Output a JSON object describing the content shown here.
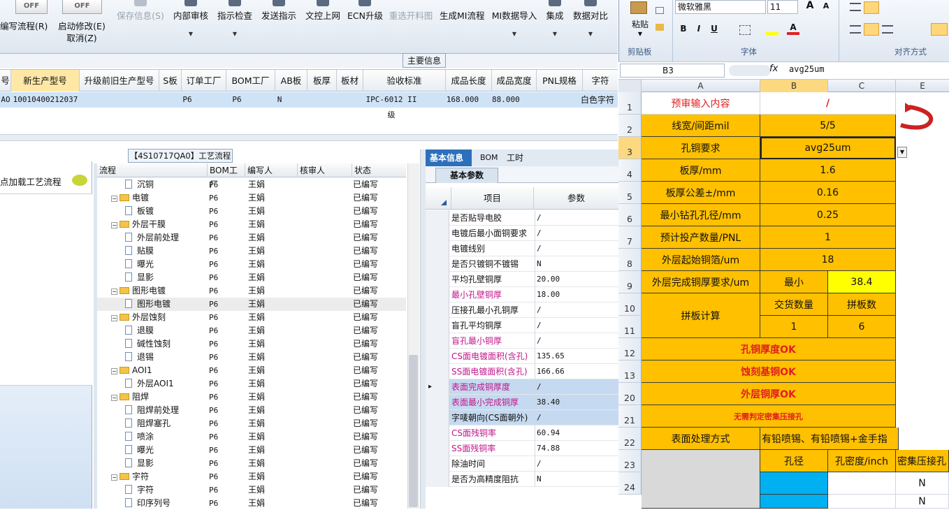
{
  "toolbar": {
    "toggle1": "OFF",
    "toggle2": "OFF",
    "btn_flow": "编写流程(R)",
    "btn_auto": "启动修改(E)",
    "btn_cancel": "取消(Z)",
    "btn_save": "保存信息(S)",
    "btn_audit": "内部审核",
    "btn_check": "指示检查",
    "btn_send": "发送指示",
    "btn_upload": "文控上网",
    "btn_ecn": "ECN升级",
    "btn_reselect": "重选开料图",
    "btn_mi": "生成MI流程",
    "btn_import": "MI数据导入",
    "btn_integrate": "集成",
    "btn_compare": "数据对比"
  },
  "main_info_label": "主要信息",
  "grid": {
    "headers": [
      "号",
      "新生产型号",
      "升级前旧生产型号",
      "S板",
      "订单工厂",
      "BOM工厂",
      "AB板",
      "板厚",
      "板材",
      "验收标准",
      "成品长度",
      "成品宽度",
      "PNL规格",
      "字符"
    ],
    "row": [
      "AO",
      "10010400212037",
      "",
      "",
      "P6",
      "P6",
      "N",
      "",
      "",
      "IPC-6012 II级",
      "168.000",
      "88.000",
      "",
      "白色字符"
    ]
  },
  "left_panel": {
    "load_label": "点加载工艺流程"
  },
  "flow_title": "【4S10717QA0】工艺流程",
  "tree": {
    "headers": [
      "流程",
      "BOM工厂",
      "编写人",
      "核审人",
      "状态"
    ],
    "rows": [
      {
        "name": "沉铜",
        "f": "P6",
        "w": "王娟",
        "s": "已编写",
        "lvl": 2
      },
      {
        "name": "电镀",
        "f": "P6",
        "w": "王娟",
        "s": "已编写",
        "lvl": 1
      },
      {
        "name": "板镀",
        "f": "P6",
        "w": "王娟",
        "s": "已编写",
        "lvl": 2
      },
      {
        "name": "外层干膜",
        "f": "P6",
        "w": "王娟",
        "s": "已编写",
        "lvl": 1
      },
      {
        "name": "外层前处理",
        "f": "P6",
        "w": "王娟",
        "s": "已编写",
        "lvl": 2
      },
      {
        "name": "贴膜",
        "f": "P6",
        "w": "王娟",
        "s": "已编写",
        "lvl": 2
      },
      {
        "name": "曝光",
        "f": "P6",
        "w": "王娟",
        "s": "已编写",
        "lvl": 2
      },
      {
        "name": "显影",
        "f": "P6",
        "w": "王娟",
        "s": "已编写",
        "lvl": 2
      },
      {
        "name": "图形电镀",
        "f": "P6",
        "w": "王娟",
        "s": "已编写",
        "lvl": 1
      },
      {
        "name": "图形电镀",
        "f": "P6",
        "w": "王娟",
        "s": "已编写",
        "lvl": 2
      },
      {
        "name": "外层蚀刻",
        "f": "P6",
        "w": "王娟",
        "s": "已编写",
        "lvl": 1
      },
      {
        "name": "退膜",
        "f": "P6",
        "w": "王娟",
        "s": "已编写",
        "lvl": 2
      },
      {
        "name": "碱性蚀刻",
        "f": "P6",
        "w": "王娟",
        "s": "已编写",
        "lvl": 2
      },
      {
        "name": "退锡",
        "f": "P6",
        "w": "王娟",
        "s": "已编写",
        "lvl": 2
      },
      {
        "name": "AOI1",
        "f": "P6",
        "w": "王娟",
        "s": "已编写",
        "lvl": 1
      },
      {
        "name": "外层AOI1",
        "f": "P6",
        "w": "王娟",
        "s": "已编写",
        "lvl": 2
      },
      {
        "name": "阻焊",
        "f": "P6",
        "w": "王娟",
        "s": "已编写",
        "lvl": 1
      },
      {
        "name": "阻焊前处理",
        "f": "P6",
        "w": "王娟",
        "s": "已编写",
        "lvl": 2
      },
      {
        "name": "阻焊塞孔",
        "f": "P6",
        "w": "王娟",
        "s": "已编写",
        "lvl": 2
      },
      {
        "name": "喷涂",
        "f": "P6",
        "w": "王娟",
        "s": "已编写",
        "lvl": 2
      },
      {
        "name": "曝光",
        "f": "P6",
        "w": "王娟",
        "s": "已编写",
        "lvl": 2
      },
      {
        "name": "显影",
        "f": "P6",
        "w": "王娟",
        "s": "已编写",
        "lvl": 2
      },
      {
        "name": "字符",
        "f": "P6",
        "w": "王娟",
        "s": "已编写",
        "lvl": 1
      },
      {
        "name": "字符",
        "f": "P6",
        "w": "王娟",
        "s": "已编写",
        "lvl": 2
      },
      {
        "name": "印序列号",
        "f": "P6",
        "w": "王娟",
        "s": "已编写",
        "lvl": 2
      }
    ]
  },
  "params": {
    "tabs": [
      "基本信息",
      "BOM",
      "工时"
    ],
    "subtab": "基本参数",
    "headers": [
      "项目",
      "参数"
    ],
    "rows": [
      {
        "k": "是否贴导电胶",
        "v": "/",
        "pink": false
      },
      {
        "k": "电镀后最小面铜要求",
        "v": "/",
        "pink": false
      },
      {
        "k": "电镀线别",
        "v": "/",
        "pink": false
      },
      {
        "k": "是否只镀铜不镀锡",
        "v": "N",
        "pink": false
      },
      {
        "k": "平均孔壁铜厚",
        "v": "20.00",
        "pink": false
      },
      {
        "k": "最小孔壁铜厚",
        "v": "18.00",
        "pink": true
      },
      {
        "k": "压接孔最小孔铜厚",
        "v": "/",
        "pink": false
      },
      {
        "k": "盲孔平均铜厚",
        "v": "/",
        "pink": false
      },
      {
        "k": "盲孔最小铜厚",
        "v": "/",
        "pink": true
      },
      {
        "k": "CS面电镀面积(含孔)",
        "v": "135.65",
        "pink": true
      },
      {
        "k": "SS面电镀面积(含孔)",
        "v": "166.66",
        "pink": true
      },
      {
        "k": "表面完成铜厚度",
        "v": "/",
        "pink": true
      },
      {
        "k": "表面最小完成铜厚",
        "v": "38.40",
        "pink": true
      },
      {
        "k": "字唛朝向(CS面朝外)",
        "v": "/",
        "pink": false
      },
      {
        "k": "CS面残铜率",
        "v": "60.94",
        "pink": true
      },
      {
        "k": "SS面残铜率",
        "v": "74.88",
        "pink": true
      },
      {
        "k": "除油时间",
        "v": "/",
        "pink": false
      },
      {
        "k": "是否为高精度阻抗",
        "v": "N",
        "pink": false
      }
    ]
  },
  "excel": {
    "font_name": "微软雅黑",
    "font_size": "11",
    "paste": "粘贴",
    "clipboard": "剪贴板",
    "font_group": "字体",
    "align_group": "对齐方式",
    "namebox": "B3",
    "fx": "fx",
    "formula": "avg25um",
    "cols": [
      "A",
      "B",
      "C",
      "E"
    ],
    "row_nums": [
      "1",
      "2",
      "3",
      "4",
      "5",
      "6",
      "7",
      "8",
      "9",
      "10",
      "11",
      "12",
      "13",
      "20",
      "21",
      "22",
      "23",
      "24"
    ],
    "cells": {
      "a1": "预审输入内容",
      "b1": "/",
      "a2": "线宽/间距mil",
      "b2": "5/5",
      "a3": "孔铜要求",
      "b3": "avg25um",
      "a4": "板厚/mm",
      "b4": "1.6",
      "a5": "板厚公差±/mm",
      "b5": "0.16",
      "a6": "最小钻孔孔径/mm",
      "b6": "0.25",
      "a7": "预计投产数量/PNL",
      "b7": "1",
      "a8": "外层起始铜箔/um",
      "b8": "18",
      "a9": "外层完成铜厚要求/um",
      "b9": "最小",
      "c9": "38.4",
      "a10": "拼板计算",
      "b10": "交货数量",
      "c10": "拼板数",
      "b11": "1",
      "c11": "6",
      "r12": "孔铜厚度OK",
      "r13": "蚀刻基铜OK",
      "r20": "外层铜厚OK",
      "r21": "无需判定密集压接孔",
      "a22": "表面处理方式",
      "b22": "有铅喷锡、有铅喷锡+金手指",
      "b23": "孔径",
      "c23": "孔密度/inch",
      "e23": "密集压接孔",
      "e24": "N",
      "e25": "N"
    }
  }
}
